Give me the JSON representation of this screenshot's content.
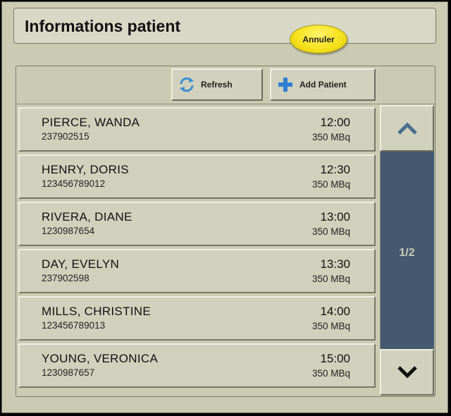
{
  "header": {
    "title": "Informations patient",
    "cancel_label": "Annuler"
  },
  "toolbar": {
    "refresh_label": "Refresh",
    "refresh_icon": "refresh-icon",
    "add_label": "Add Patient",
    "add_icon": "plus-icon"
  },
  "patients": [
    {
      "name": "PIERCE, WANDA",
      "id": "237902515",
      "time": "12:00",
      "dose": "350 MBq"
    },
    {
      "name": "HENRY, DORIS",
      "id": "123456789012",
      "time": "12:30",
      "dose": "350 MBq"
    },
    {
      "name": "RIVERA, DIANE",
      "id": "1230987654",
      "time": "13:00",
      "dose": "350 MBq"
    },
    {
      "name": "DAY, EVELYN",
      "id": "237902598",
      "time": "13:30",
      "dose": "350 MBq"
    },
    {
      "name": "MILLS, CHRISTINE",
      "id": "123456789013",
      "time": "14:00",
      "dose": "350 MBq"
    },
    {
      "name": "YOUNG, VERONICA",
      "id": "1230987657",
      "time": "15:00",
      "dose": "350 MBq"
    }
  ],
  "pagination": {
    "page_indicator": "1/2",
    "up_icon": "chevron-up-icon",
    "down_icon": "chevron-down-icon"
  },
  "colors": {
    "background": "#cbcbb4",
    "cancel_button": "#f6e21c",
    "scroll_track": "#44596f",
    "scroll_up_chevron": "#4a6f8f"
  }
}
